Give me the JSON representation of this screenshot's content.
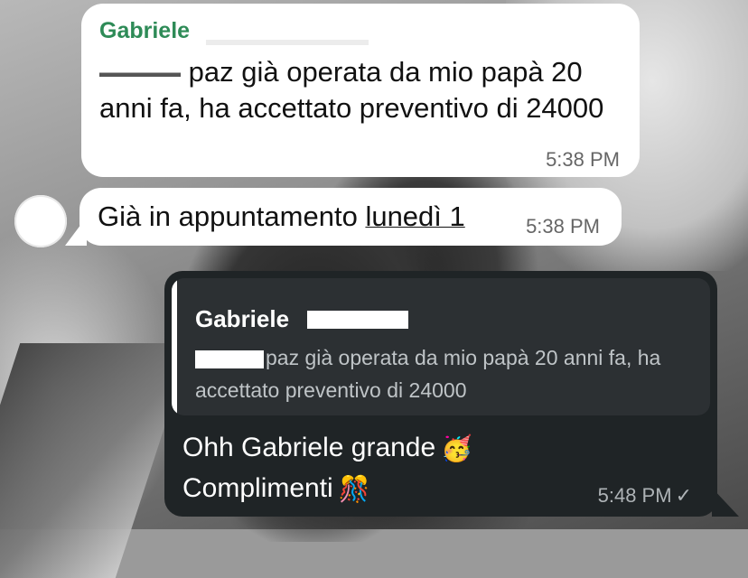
{
  "messages": [
    {
      "sender": "Gabriele",
      "text_visible": "paz già operata da mio papà 20 anni fa, ha accettato preventivo di 24000",
      "time": "5:38 PM"
    },
    {
      "text_prefix": "Già in appuntamento ",
      "text_link": "lunedì 1",
      "time": "5:38 PM"
    },
    {
      "quote": {
        "sender": "Gabriele",
        "text_visible": "paz già operata da mio papà 20 anni fa, ha accettato preventivo di 24000"
      },
      "line1": "Ohh  Gabriele grande",
      "line1_emoji": "🥳",
      "line2": "Complimenti",
      "line2_emoji": "🎊",
      "time": "5:48 PM",
      "status_icon": "check-icon"
    }
  ],
  "colors": {
    "incoming_bubble": "#ffffff",
    "outgoing_bubble": "#1f2426",
    "sender_name": "#2e8b57"
  }
}
